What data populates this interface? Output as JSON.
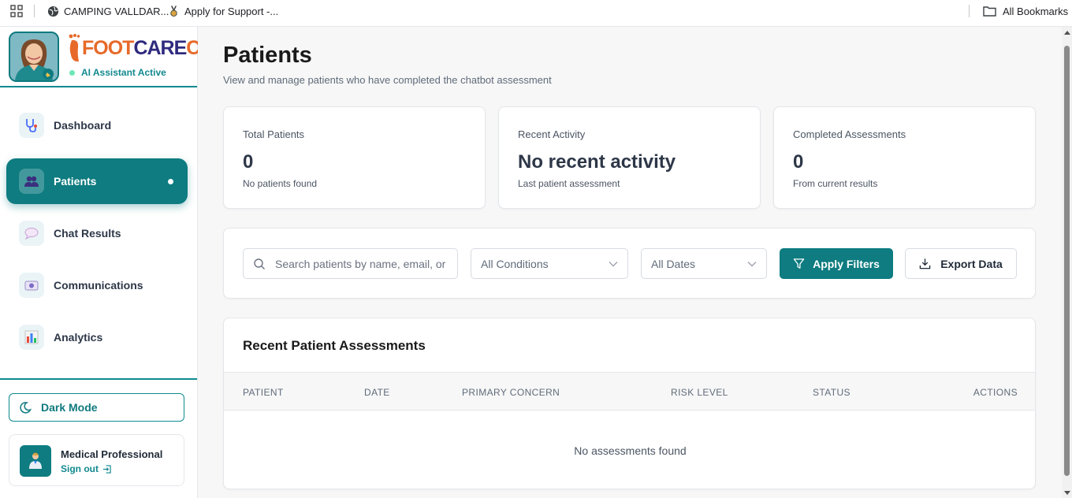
{
  "bookmarks": {
    "items": [
      {
        "label": "CAMPING VALLDAR...",
        "icon": "globe-icon"
      },
      {
        "label": "Apply for Support  -...",
        "icon": "ribbon-icon"
      }
    ],
    "all_bookmarks": "All Bookmarks"
  },
  "sidebar": {
    "logo": {
      "part1": "FOOT",
      "part2": "CARE",
      "part3": "CLINIC"
    },
    "ai_status": "AI Assistant Active",
    "nav": [
      {
        "label": "Dashboard",
        "icon": "stethoscope-icon"
      },
      {
        "label": "Patients",
        "icon": "patients-icon",
        "active": true
      },
      {
        "label": "Chat Results",
        "icon": "speech-bubble-icon"
      },
      {
        "label": "Communications",
        "icon": "communications-icon"
      },
      {
        "label": "Analytics",
        "icon": "bar-chart-icon"
      }
    ],
    "dark_mode": "Dark Mode",
    "user": {
      "name": "Medical Professional",
      "sign_out": "Sign out"
    }
  },
  "main": {
    "title": "Patients",
    "subtitle": "View and manage patients who have completed the chatbot assessment",
    "stats": [
      {
        "label": "Total Patients",
        "value": "0",
        "note": "No patients found"
      },
      {
        "label": "Recent Activity",
        "value": "No recent activity",
        "note": "Last patient assessment"
      },
      {
        "label": "Completed Assessments",
        "value": "0",
        "note": "From current results"
      }
    ],
    "filters": {
      "search_placeholder": "Search patients by name, email, or phone",
      "conditions": "All Conditions",
      "dates": "All Dates",
      "apply": "Apply Filters",
      "export": "Export Data"
    },
    "table": {
      "title": "Recent Patient Assessments",
      "columns": [
        "PATIENT",
        "DATE",
        "PRIMARY CONCERN",
        "RISK LEVEL",
        "STATUS",
        "ACTIONS"
      ],
      "empty": "No assessments found"
    }
  },
  "colors": {
    "accent": "#0e7c80",
    "brand_orange": "#e76a2a",
    "brand_navy": "#2e2a7e"
  }
}
